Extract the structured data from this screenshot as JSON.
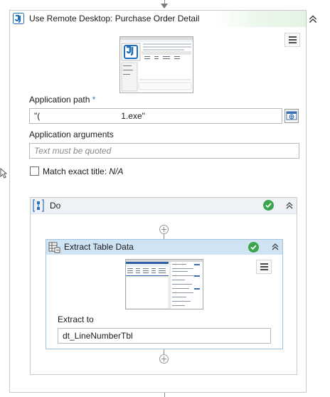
{
  "outer_activity": {
    "title": "Use Remote Desktop: Purchase Order Detail",
    "fields": {
      "application_path_label": "Application path",
      "required_marker": "*",
      "application_path_value_start": "\"(",
      "application_path_value_end": "1.exe\"",
      "application_arguments_label": "Application arguments",
      "application_arguments_placeholder": "Text must be quoted",
      "match_exact_title_label": "Match exact title:",
      "match_exact_title_value": "N/A"
    }
  },
  "do_container": {
    "title": "Do"
  },
  "extract_table_data": {
    "title": "Extract Table Data",
    "extract_to_label": "Extract to",
    "extract_to_value": "dt_LineNumberTbl"
  },
  "colors": {
    "accent_blue": "#1f6fb8",
    "success_green": "#3aa54a",
    "selected_header": "#cfe3f3"
  },
  "icons": [
    "uipath-logo-icon",
    "collapse-chevron-icon",
    "menu-icon",
    "browse-target-icon",
    "sequence-icon",
    "check-icon",
    "add-activity-icon",
    "table-extract-icon",
    "mouse-cursor-icon"
  ]
}
